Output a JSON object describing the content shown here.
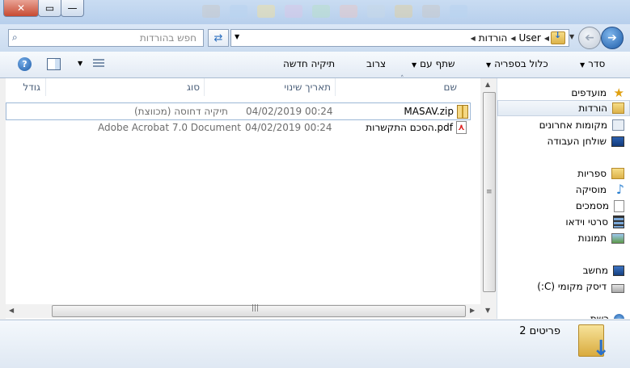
{
  "window": {
    "close_glyph": "✕",
    "max_glyph": "▭",
    "min_glyph": "—"
  },
  "address": {
    "crumbs": [
      "User",
      "הורדות"
    ],
    "refresh_glyph": "⇄"
  },
  "search": {
    "placeholder": "חפש בהורדות"
  },
  "toolbar": {
    "organize": "סדר",
    "include_in_library": "כלול בספריה",
    "share_with": "שתף עם",
    "burn": "צרוב",
    "new_folder": "תיקיה חדשה"
  },
  "columns": {
    "name": "שם",
    "date_modified": "תאריך שינוי",
    "type": "סוג",
    "size": "גודל"
  },
  "files": [
    {
      "name": "MASAV.zip",
      "date": "04/02/2019 00:24",
      "type": "תיקיה דחוסה (מכווצת)",
      "icon": "zip-folder-icon"
    },
    {
      "name": "הסכם התקשרות.pdf",
      "date": "04/02/2019 00:24",
      "type": "Adobe Acrobat 7.0 Document",
      "icon": "pdf-icon"
    }
  ],
  "nav": {
    "favorites": "מועדפים",
    "downloads": "הורדות",
    "recent_places": "מקומות אחרונים",
    "desktop": "שולחן העבודה",
    "libraries": "ספריות",
    "music": "מוסיקה",
    "documents": "מסמכים",
    "videos": "סרטי וידאו",
    "pictures": "תמונות",
    "computer": "מחשב",
    "local_disk": "דיסק מקומי (C:)",
    "network": "רשת"
  },
  "details": {
    "item_count": "2 פריטים"
  },
  "colors": {
    "accent": "#1d5ca8",
    "selection_border": "#9cb7d6"
  }
}
